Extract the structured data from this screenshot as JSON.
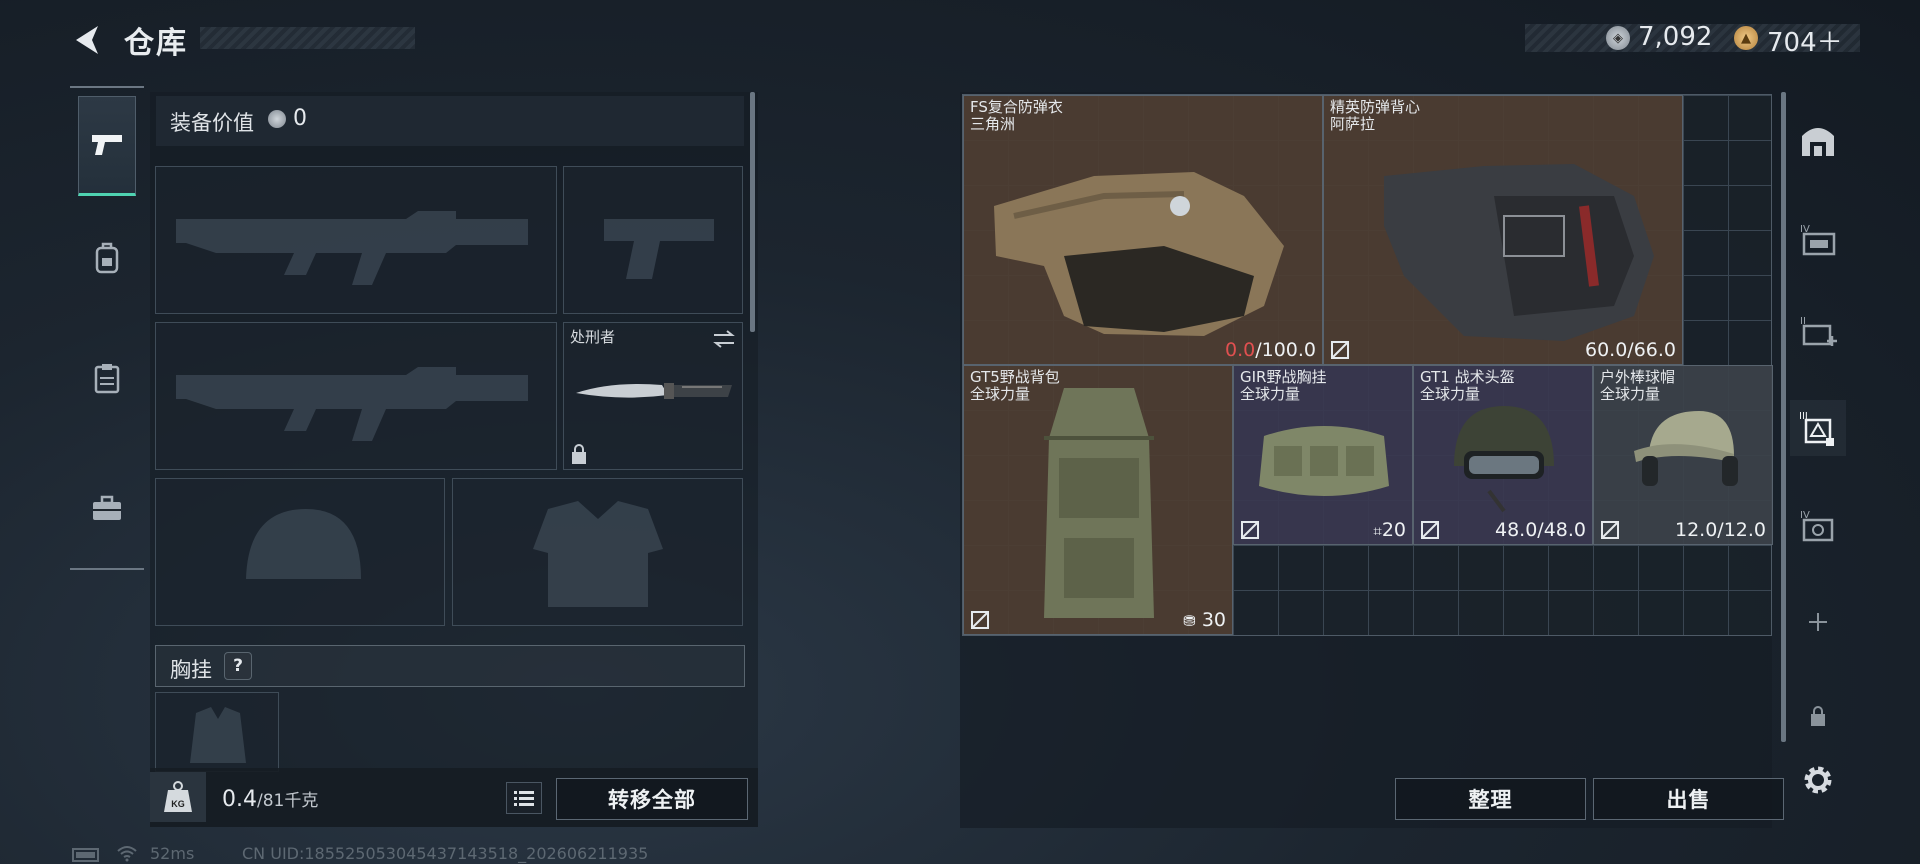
{
  "header": {
    "title": "仓库",
    "currency1": "7,092",
    "currency2": "704＋"
  },
  "loadout": {
    "equip_value_label": "装备价值",
    "equip_value": "0",
    "melee_name": "处刑者",
    "chest_rig_label": "胸挂",
    "chest_rig_help": "?",
    "weight_current": "0.4",
    "weight_max": "/81千克",
    "transfer_all": "转移全部",
    "weight_icon_text": "KG"
  },
  "stash": {
    "items": [
      {
        "name": "FS复合防弹衣",
        "faction": "三角洲",
        "dur_current": "0.0",
        "dur_max": "/100.0"
      },
      {
        "name": "精英防弹背心",
        "faction": "阿萨拉",
        "durability": "60.0/66.0"
      },
      {
        "name": "GT5野战背包",
        "faction": "全球力量",
        "capacity": "30"
      },
      {
        "name": "GIR野战胸挂",
        "faction": "全球力量",
        "capacity": "20"
      },
      {
        "name": "GT1 战术头盔",
        "faction": "全球力量",
        "durability": "48.0/48.0"
      },
      {
        "name": "户外棒球帽",
        "faction": "全球力量",
        "durability": "12.0/12.0"
      }
    ],
    "sort_button": "整理",
    "sell_button": "出售"
  },
  "status": {
    "ping": "52ms",
    "uid": "CN UID:1855250530454371435​18_202606211935"
  },
  "colors": {
    "accent": "#4fd3b1",
    "durability_zero": "#e05050"
  }
}
